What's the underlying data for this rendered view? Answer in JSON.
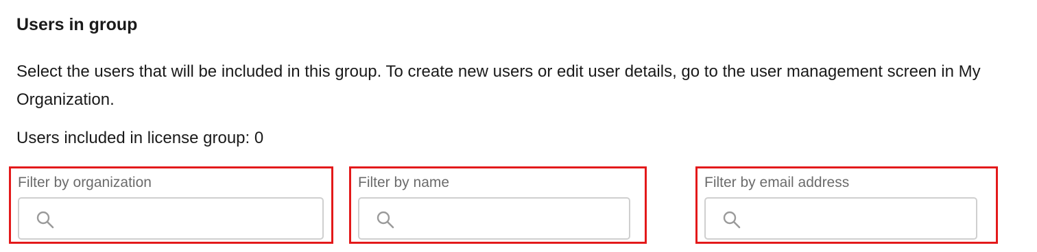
{
  "section": {
    "title": "Users in group",
    "description": "Select the users that will be included in this group. To create new users or edit user details, go to the user management screen in My Organization.",
    "count_text": "Users included in license group: 0"
  },
  "filters": {
    "organization": {
      "label": "Filter by organization",
      "value": "",
      "icon": "search-icon"
    },
    "name": {
      "label": "Filter by name",
      "value": "",
      "icon": "search-icon"
    },
    "email": {
      "label": "Filter by email address",
      "value": "",
      "icon": "search-icon"
    }
  },
  "colors": {
    "highlight_border": "#e3191a",
    "input_border": "#cfcfcf",
    "label_text": "#6b6b6b",
    "body_text": "#1a1a1a",
    "icon": "#9a9a9a"
  }
}
